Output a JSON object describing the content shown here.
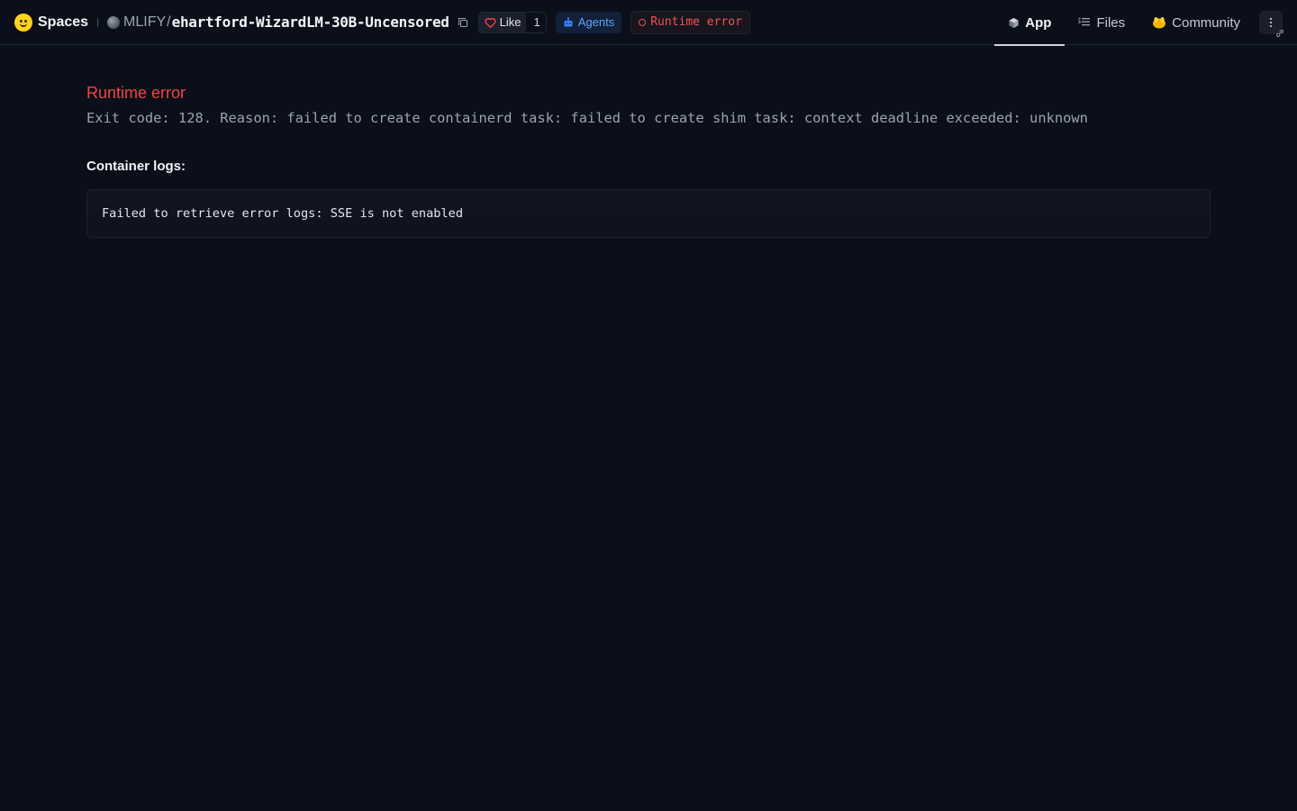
{
  "header": {
    "spaces_label": "Spaces",
    "owner": "MLIFY",
    "separator": "/",
    "repo_name": "ehartford-WizardLM-30B-Uncensored",
    "like_label": "Like",
    "like_count": "1",
    "agents_label": "Agents",
    "status": "Runtime error",
    "status_color": "#f05252",
    "icons": {
      "logo": "hugging-face-emoji",
      "copy": "copy-icon",
      "like": "heart-icon",
      "agents": "robot-icon",
      "status": "circle-icon"
    }
  },
  "nav": {
    "tabs": [
      {
        "label": "App",
        "icon": "cube-icon",
        "active": true
      },
      {
        "label": "Files",
        "icon": "files-list-icon",
        "active": false
      },
      {
        "label": "Community",
        "icon": "hands-emoji-icon",
        "active": false
      }
    ],
    "more_icon": "more-vertical-icon"
  },
  "main": {
    "error_title": "Runtime error",
    "error_reason": "Exit code: 128. Reason: failed to create containerd task: failed to create shim task: context deadline exceeded: unknown",
    "logs_heading": "Container logs:",
    "log_text": "Failed to retrieve error logs: SSE is not enabled"
  },
  "colors": {
    "background": "#0b0f19",
    "error": "#ef4444",
    "agents": "#60a5fa"
  }
}
